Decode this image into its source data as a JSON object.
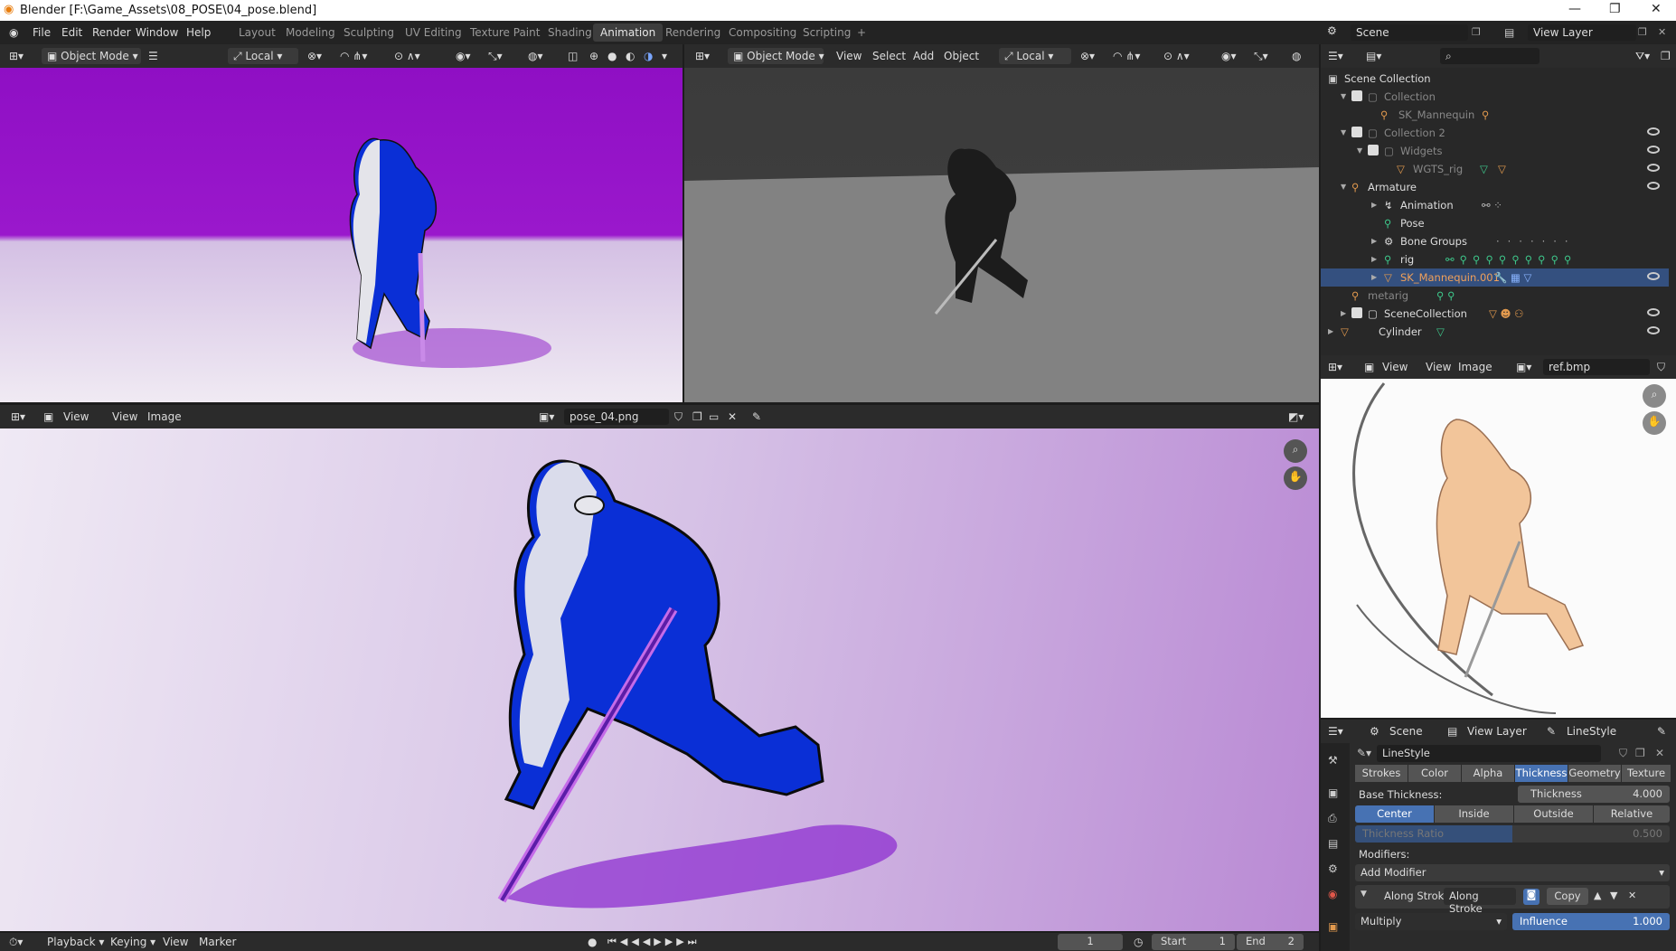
{
  "window": {
    "title": "Blender [F:\\Game_Assets\\08_POSE\\04_pose.blend]"
  },
  "menu": [
    "File",
    "Edit",
    "Render",
    "Window",
    "Help"
  ],
  "workspaces": [
    "Layout",
    "Modeling",
    "Sculpting",
    "UV Editing",
    "Texture Paint",
    "Shading",
    "Animation",
    "Rendering",
    "Compositing",
    "Scripting",
    "+"
  ],
  "active_workspace": "Animation",
  "scene_selector": {
    "scene": "Scene",
    "view_layer": "View Layer"
  },
  "viewport_left": {
    "mode": "Object Mode",
    "orientation": "Local"
  },
  "viewport_right": {
    "mode": "Object Mode",
    "menus": [
      "View",
      "Select",
      "Add",
      "Object"
    ],
    "orientation": "Local"
  },
  "image_editor_main": {
    "menus": [
      "View",
      "View",
      "Image"
    ],
    "image_name": "pose_04.png"
  },
  "image_editor_ref": {
    "menus": [
      "View",
      "View",
      "Image"
    ],
    "image_name": "ref.bmp"
  },
  "outliner": {
    "rows": [
      {
        "label": "Scene Collection",
        "indent": 0,
        "dim": false
      },
      {
        "label": "Collection",
        "indent": 1,
        "dim": true
      },
      {
        "label": "SK_Mannequin",
        "indent": 2,
        "dim": true
      },
      {
        "label": "Collection 2",
        "indent": 1,
        "dim": true
      },
      {
        "label": "Widgets",
        "indent": 2,
        "dim": true
      },
      {
        "label": "WGTS_rig",
        "indent": 3,
        "dim": true
      },
      {
        "label": "Armature",
        "indent": 1,
        "dim": false
      },
      {
        "label": "Animation",
        "indent": 2,
        "dim": false
      },
      {
        "label": "Pose",
        "indent": 2,
        "dim": false
      },
      {
        "label": "Bone Groups",
        "indent": 2,
        "dim": false
      },
      {
        "label": "rig",
        "indent": 2,
        "dim": false
      },
      {
        "label": "SK_Mannequin.001",
        "indent": 2,
        "dim": false,
        "selected": true
      },
      {
        "label": "metarig",
        "indent": 1,
        "dim": true
      },
      {
        "label": "SceneCollection",
        "indent": 1,
        "dim": false
      },
      {
        "label": "Cylinder",
        "indent": 1,
        "dim": false
      }
    ]
  },
  "properties": {
    "breadcrumb": [
      "Scene",
      "View Layer",
      "LineStyle"
    ],
    "datablock": "LineStyle",
    "tabs": [
      "Strokes",
      "Color",
      "Alpha",
      "Thickness",
      "Geometry",
      "Texture"
    ],
    "active_tab": "Thickness",
    "base_thickness_label": "Base Thickness:",
    "thickness_label": "Thickness",
    "thickness_value": "4.000",
    "thickness_position": [
      "Center",
      "Inside",
      "Outside",
      "Relative"
    ],
    "thickness_ratio_label": "Thickness Ratio",
    "thickness_ratio_value": "0.500",
    "modifiers_label": "Modifiers:",
    "add_modifier": "Add Modifier",
    "modifier": {
      "name": "Along Stroke",
      "type": "Along Stroke",
      "copy": "Copy",
      "blend": "Multiply",
      "influence_label": "Influence",
      "influence_value": "1.000"
    }
  },
  "timeline": {
    "menus": [
      "Playback",
      "Keying",
      "View",
      "Marker"
    ],
    "current_frame": "1",
    "start_label": "Start",
    "start_value": "1",
    "end_label": "End",
    "end_value": "2"
  },
  "colors": {
    "accent": "#4772b3",
    "viewport_purple": "#9a18cc",
    "figure_blue": "#0a2fd6"
  }
}
